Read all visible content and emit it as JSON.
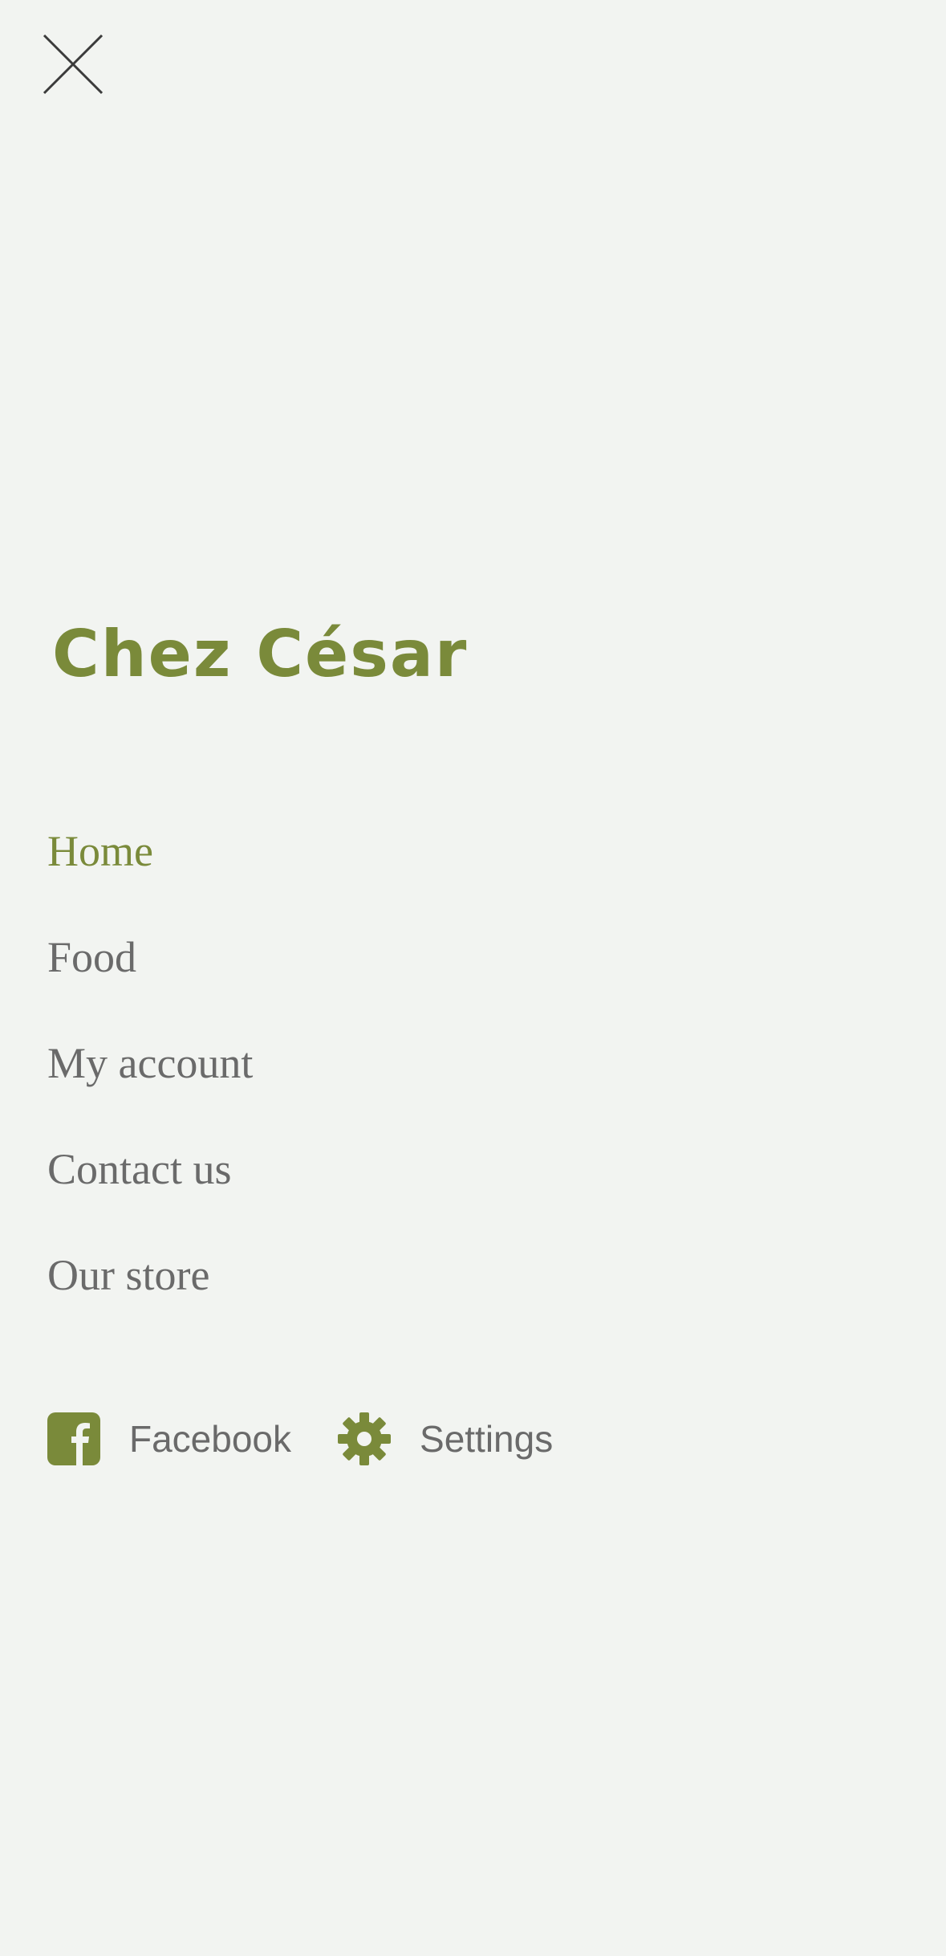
{
  "header": {
    "close_icon": "close-icon"
  },
  "brand": {
    "title": "Chez César",
    "accent_color": "#7a8a3a"
  },
  "nav": {
    "items": [
      {
        "label": "Home",
        "active": true
      },
      {
        "label": "Food",
        "active": false
      },
      {
        "label": "My account",
        "active": false
      },
      {
        "label": "Contact us",
        "active": false
      },
      {
        "label": "Our store",
        "active": false
      }
    ]
  },
  "footer": {
    "facebook_label": "Facebook",
    "facebook_icon": "facebook-icon",
    "settings_label": "Settings",
    "settings_icon": "gear-icon"
  },
  "colors": {
    "background": "#f2f4f1",
    "text": "#6a6a6a",
    "accent": "#7a8a3a"
  }
}
